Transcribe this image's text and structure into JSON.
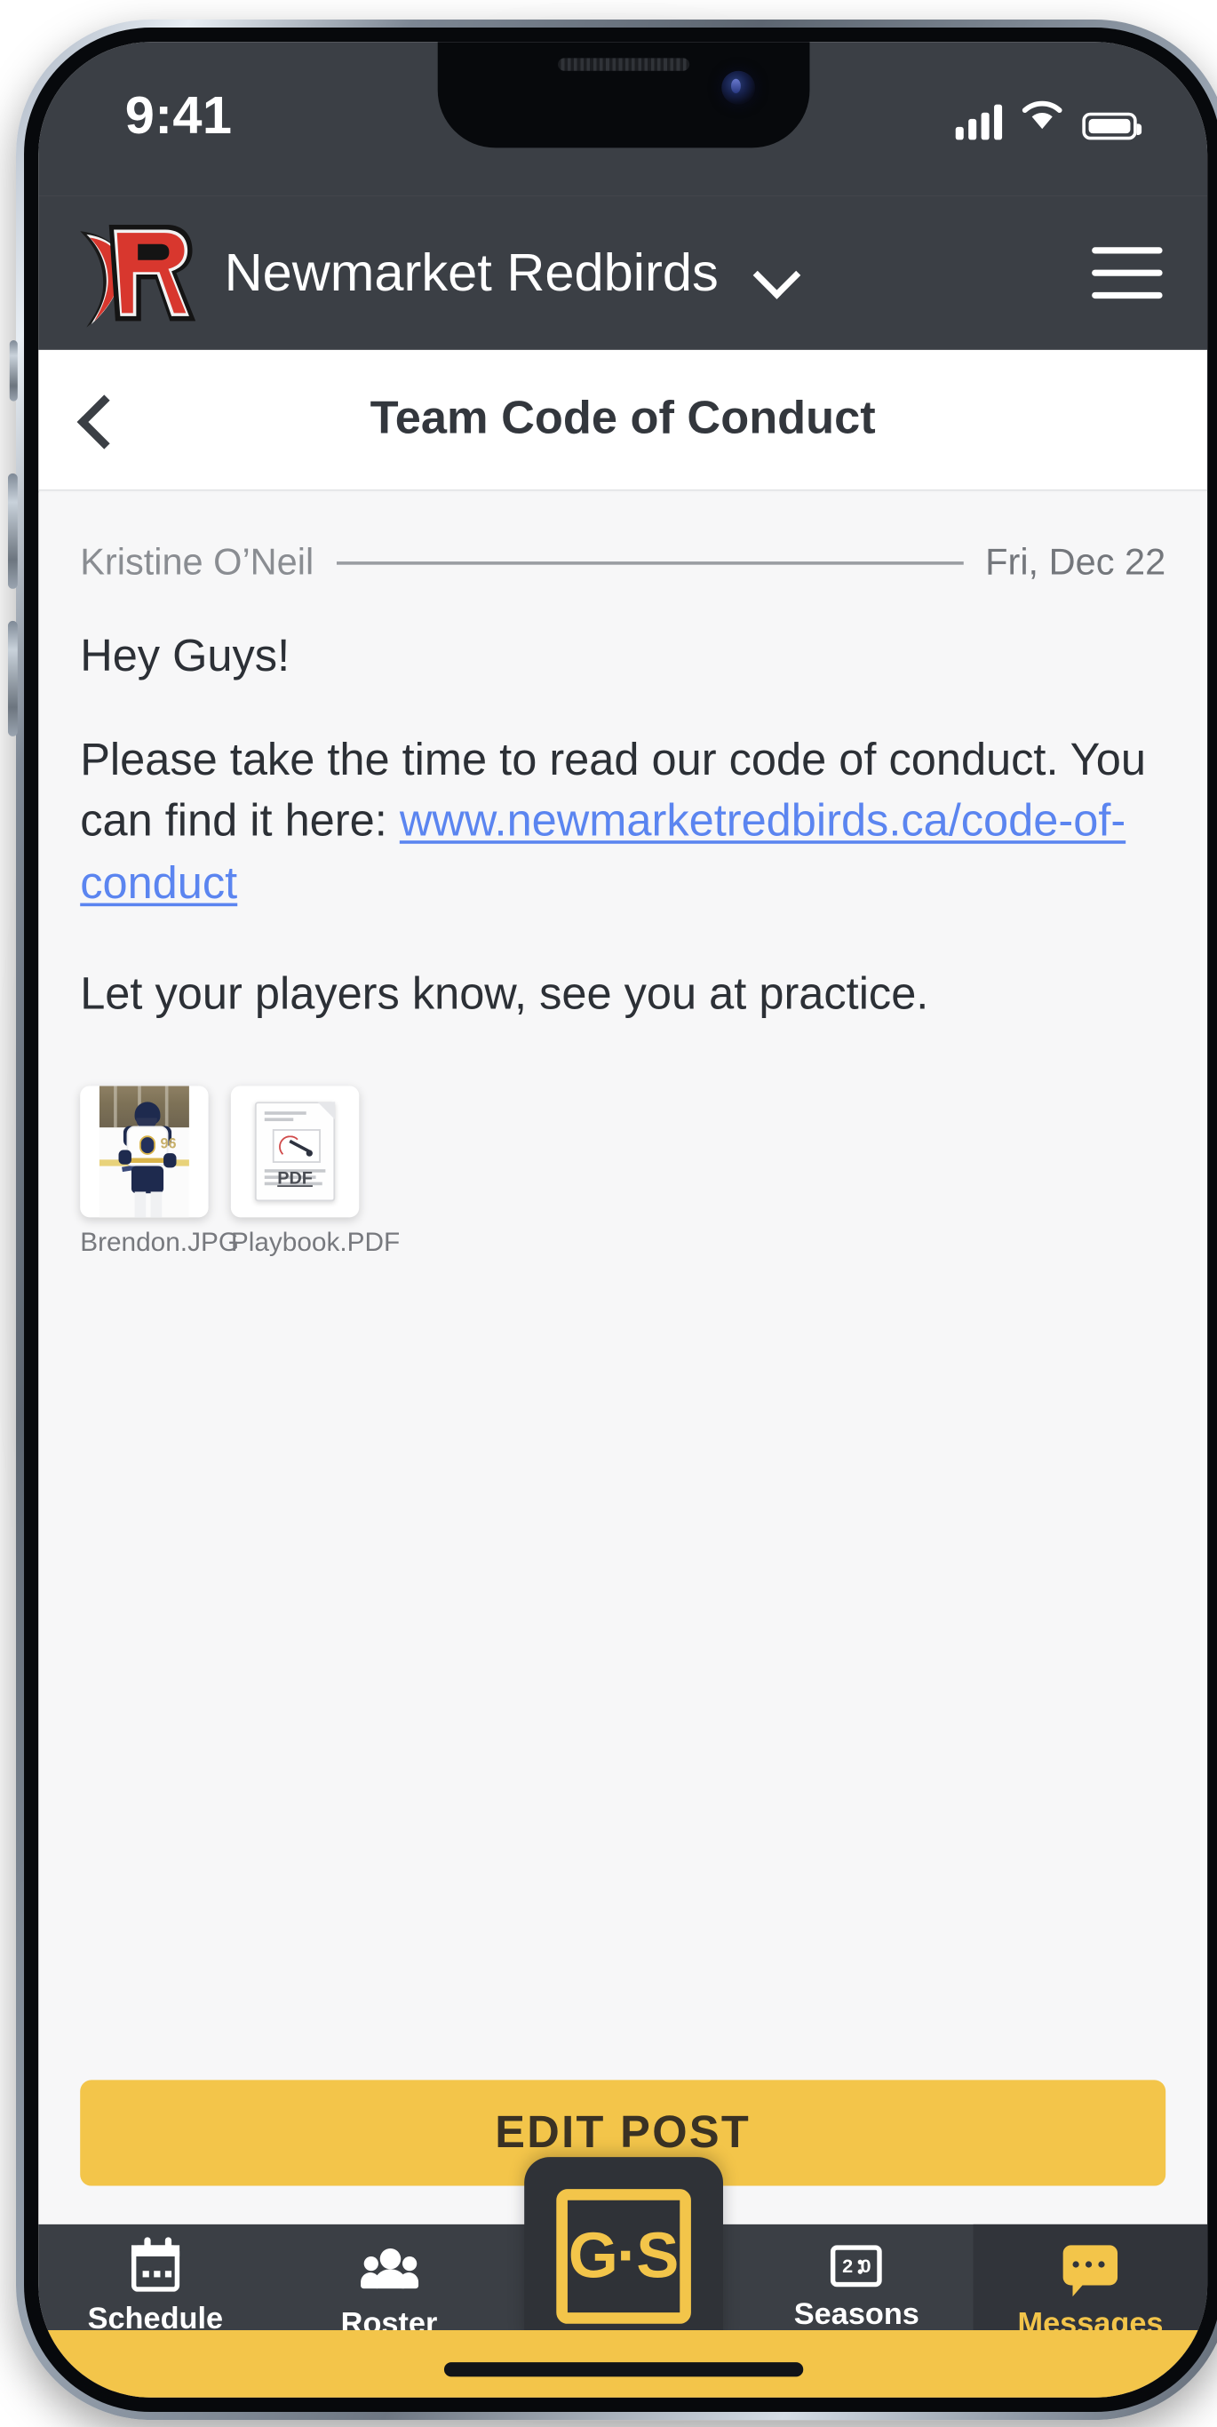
{
  "status_bar": {
    "time": "9:41",
    "signal_icon": "cellular-signal-icon",
    "wifi_icon": "wifi-icon",
    "battery_icon": "battery-full-icon"
  },
  "app_header": {
    "team_name": "Newmarket Redbirds",
    "logo_alt": "redbirds-logo",
    "team_switch_icon": "chevron-down-icon",
    "menu_icon": "hamburger-menu-icon"
  },
  "page_header": {
    "back_icon": "chevron-left-icon",
    "title": "Team Code of Conduct"
  },
  "message": {
    "author": "Kristine O’Neil",
    "date": "Fri, Dec 22",
    "greeting": "Hey Guys!",
    "paragraph_lead": "Please take the time to read our code of conduct. You can find it here: ",
    "link_text": "www.newmarketredbirds.ca/code-of-conduct",
    "closing": "Let your players know, see you at practice."
  },
  "attachments": [
    {
      "name": "Brendon.JPG",
      "type": "image",
      "icon": "photo-thumbnail-icon"
    },
    {
      "name": "Playbook.PDF",
      "type": "pdf",
      "icon": "pdf-file-icon",
      "badge": "PDF"
    }
  ],
  "actions": {
    "edit_post_label": "EDIT POST"
  },
  "bottom_nav": {
    "items": [
      {
        "label": "Schedule",
        "icon": "calendar-icon",
        "active": false
      },
      {
        "label": "Roster",
        "icon": "people-icon",
        "active": false
      },
      {
        "label": "Seasons",
        "icon": "scoreboard-icon",
        "active": false
      },
      {
        "label": "Messages",
        "icon": "chat-bubble-icon",
        "active": true
      }
    ],
    "center_button": {
      "label": "G·S",
      "icon": "gamesheet-logo-icon"
    }
  },
  "colors": {
    "header_bg": "#3b3f45",
    "accent_gold": "#f3c54a",
    "link_blue": "#5b85f0",
    "logo_red": "#d8372e",
    "content_bg": "#f7f7f8"
  }
}
